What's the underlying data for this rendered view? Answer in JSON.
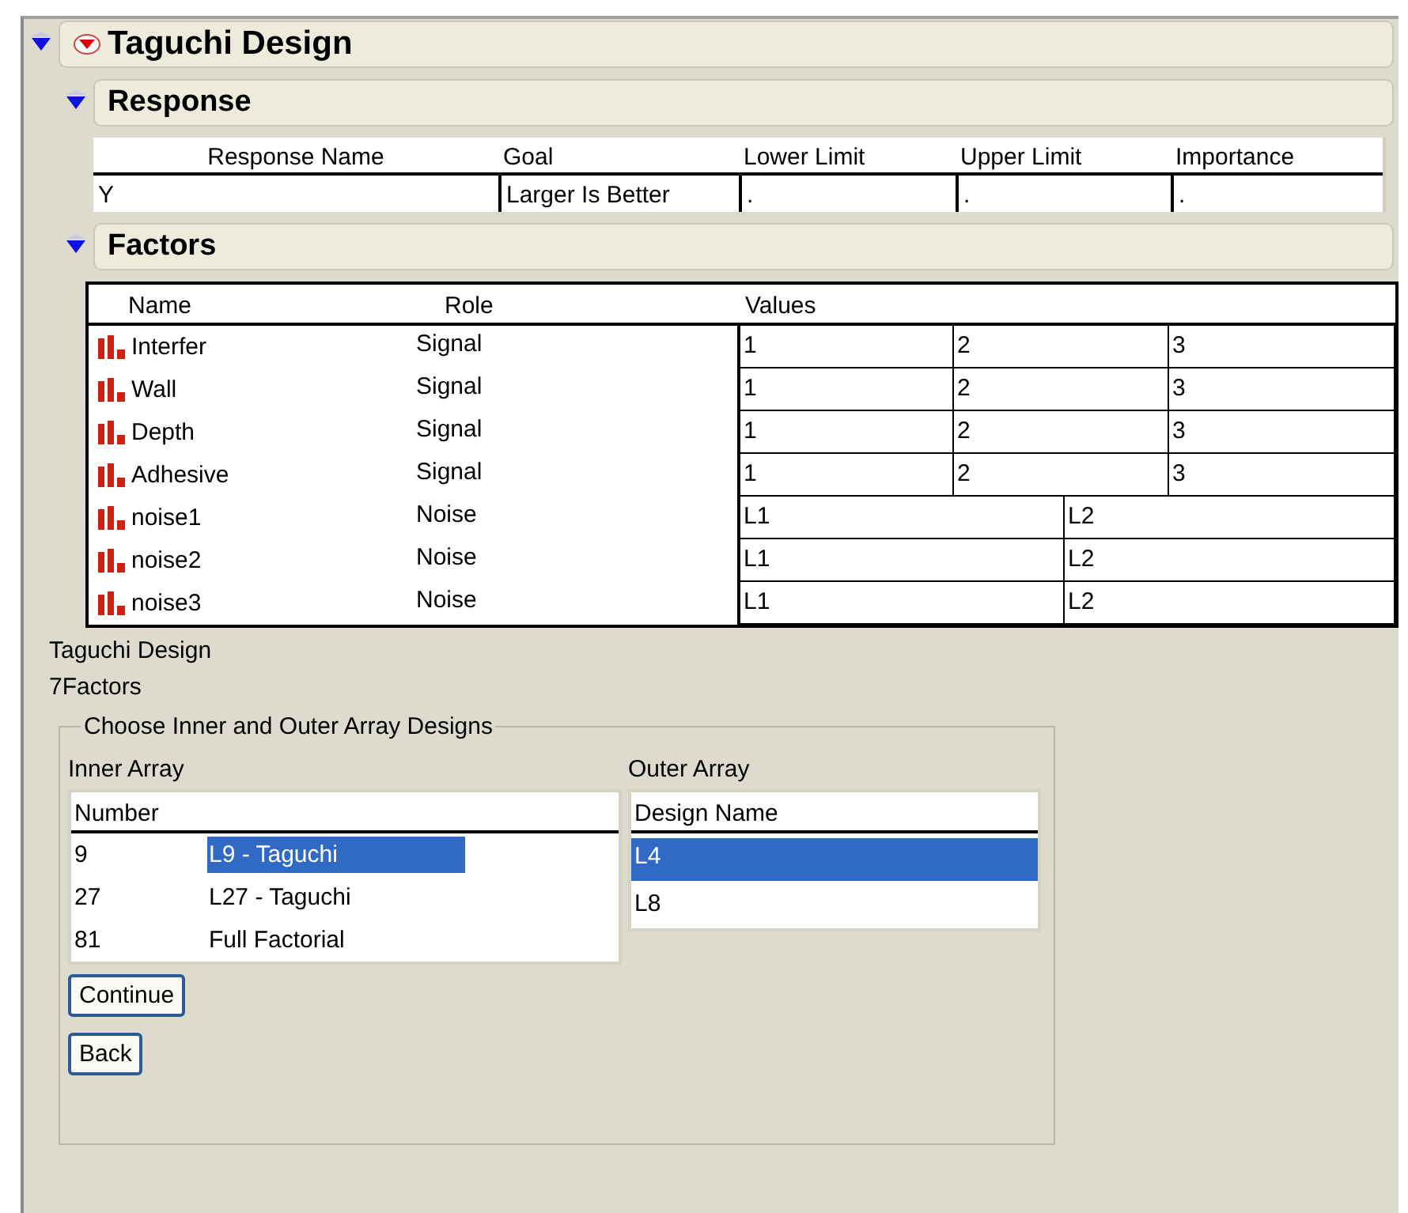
{
  "title": "Taguchi Design",
  "expanded": true,
  "response": {
    "title": "Response",
    "expanded": true,
    "columns": [
      "Response Name",
      "Goal",
      "Lower Limit",
      "Upper Limit",
      "Importance"
    ],
    "rows": [
      [
        "Y",
        "Larger Is Better",
        ".",
        ".",
        "."
      ]
    ]
  },
  "factors": {
    "title": "Factors",
    "expanded": true,
    "columns": [
      "Name",
      "Role",
      "Values"
    ],
    "rows": [
      {
        "name": "Interfer",
        "role": "Signal",
        "values": [
          "1",
          "2",
          "3"
        ]
      },
      {
        "name": "Wall",
        "role": "Signal",
        "values": [
          "1",
          "2",
          "3"
        ]
      },
      {
        "name": "Depth",
        "role": "Signal",
        "values": [
          "1",
          "2",
          "3"
        ]
      },
      {
        "name": "Adhesive",
        "role": "Signal",
        "values": [
          "1",
          "2",
          "3"
        ]
      },
      {
        "name": "noise1",
        "role": "Noise",
        "values": [
          "L1",
          "L2"
        ]
      },
      {
        "name": "noise2",
        "role": "Noise",
        "values": [
          "L1",
          "L2"
        ]
      },
      {
        "name": "noise3",
        "role": "Noise",
        "values": [
          "L1",
          "L2"
        ]
      }
    ]
  },
  "design_label": "Taguchi Design",
  "factor_count": "7Factors",
  "chooser": {
    "legend": "Choose Inner and Outer Array Designs",
    "inner": {
      "label": "Inner Array",
      "column": "Number",
      "rows": [
        {
          "number": "9",
          "name": "L9 - Taguchi",
          "selected": true
        },
        {
          "number": "27",
          "name": "L27 - Taguchi",
          "selected": false
        },
        {
          "number": "81",
          "name": "Full Factorial",
          "selected": false
        }
      ]
    },
    "outer": {
      "label": "Outer Array",
      "column": "Design Name",
      "rows": [
        {
          "name": "L4",
          "selected": true
        },
        {
          "name": "L8",
          "selected": false
        }
      ]
    }
  },
  "buttons": [
    "Continue",
    "Back"
  ]
}
